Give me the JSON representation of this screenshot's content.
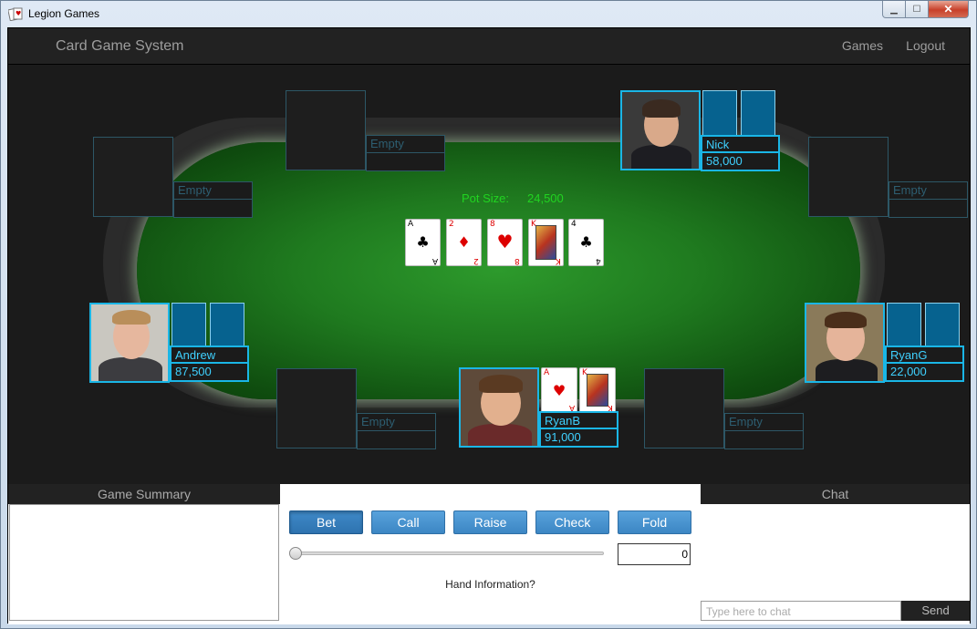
{
  "window": {
    "title": "Legion Games"
  },
  "nav": {
    "brand": "Card Game System",
    "games": "Games",
    "logout": "Logout"
  },
  "table": {
    "pot_label": "Pot Size:",
    "pot_value": "24,500",
    "community_cards": [
      {
        "rank": "A",
        "suit": "♣",
        "color": "black"
      },
      {
        "rank": "2",
        "suit": "♦",
        "color": "red"
      },
      {
        "rank": "8",
        "suit": "♥",
        "color": "red"
      },
      {
        "rank": "K",
        "suit": "♦",
        "color": "red"
      },
      {
        "rank": "4",
        "suit": "♣",
        "color": "black"
      }
    ]
  },
  "seats": {
    "top_left": {
      "name": "Empty",
      "chips": ""
    },
    "upper_left": {
      "name": "Empty",
      "chips": ""
    },
    "nick": {
      "name": "Nick",
      "chips": "58,000"
    },
    "upper_right": {
      "name": "Empty",
      "chips": ""
    },
    "andrew": {
      "name": "Andrew",
      "chips": "87,500"
    },
    "ryang": {
      "name": "RyanG",
      "chips": "22,000"
    },
    "bottom_left": {
      "name": "Empty",
      "chips": ""
    },
    "ryanb": {
      "name": "RyanB",
      "chips": "91,000",
      "hole_cards": [
        {
          "rank": "A",
          "suit": "♥",
          "color": "red"
        },
        {
          "rank": "K",
          "suit": "♦",
          "color": "red"
        }
      ]
    },
    "bottom_right": {
      "name": "Empty",
      "chips": ""
    }
  },
  "summary": {
    "header": "Game Summary"
  },
  "controls": {
    "bet": "Bet",
    "call": "Call",
    "raise": "Raise",
    "check": "Check",
    "fold": "Fold",
    "bet_amount": "0",
    "slider_value": 0,
    "hand_info": "Hand Information?"
  },
  "chat": {
    "header": "Chat",
    "placeholder": "Type here to chat",
    "send": "Send"
  },
  "colors": {
    "accent": "#1ab6e6",
    "pot": "#21d421",
    "button": "#428bca"
  }
}
